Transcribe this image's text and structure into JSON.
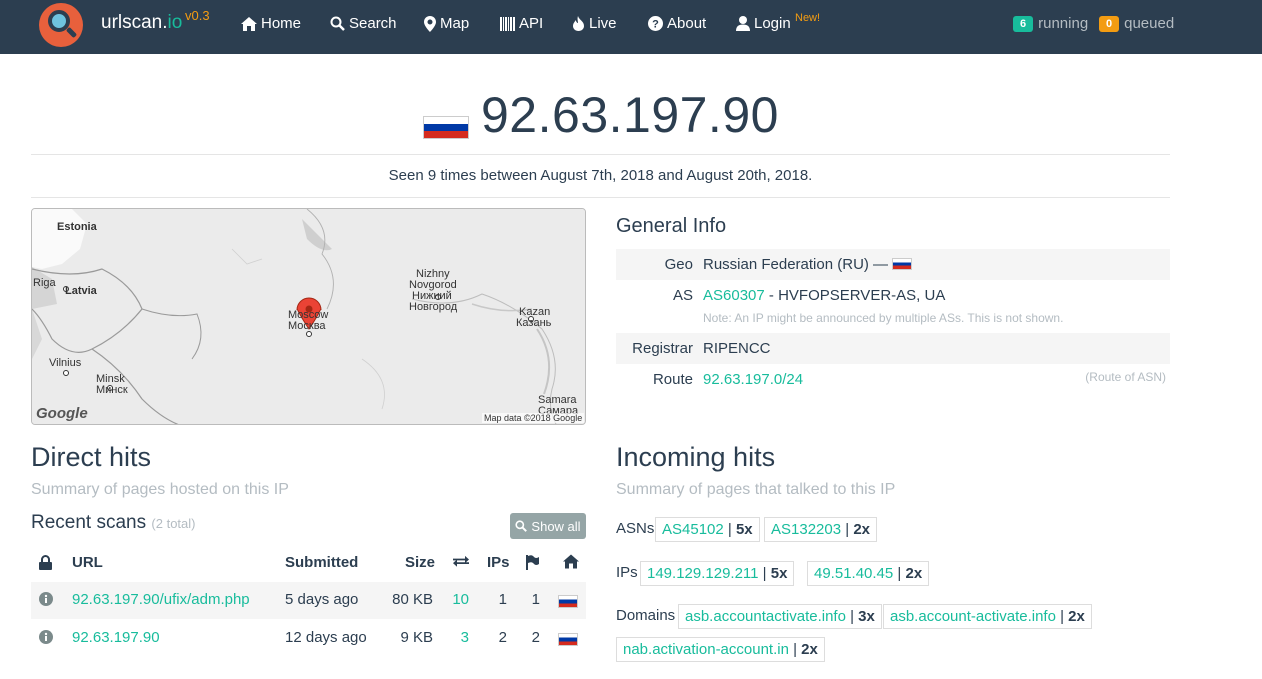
{
  "nav": {
    "brand_main": "urlscan.",
    "brand_io": "io",
    "version": "v0.3",
    "items": [
      "Home",
      "Search",
      "Map",
      "API",
      "Live",
      "About",
      "Login"
    ],
    "login_new": "New!",
    "running_count": "6",
    "running_label": "running",
    "queued_count": "0",
    "queued_label": "queued"
  },
  "hero": {
    "ip": "92.63.197.90",
    "seen": "Seen 9 times between August 7th, 2018 and August 20th, 2018."
  },
  "map": {
    "labels": {
      "estonia": "Estonia",
      "riga": "Riga",
      "latvia": "Latvia",
      "vilnius": "Vilnius",
      "minsk1": "Minsk",
      "minsk2": "Минск",
      "moscow1": "Moscow",
      "moscow2": "Москва",
      "nizhny1": "Nizhny",
      "nizhny2": "Novgorod",
      "nizhny3": "Нижний",
      "nizhny4": "Новгород",
      "kazan1": "Kazan",
      "kazan2": "Казань",
      "samara1": "Samara",
      "samara2": "Самара"
    },
    "google": "Google",
    "attribution": "Map data ©2018 Google"
  },
  "general": {
    "title": "General Info",
    "geo_key": "Geo",
    "geo_val": "Russian Federation (RU) —",
    "as_key": "AS",
    "as_link": "AS60307",
    "as_rest": " - HVFOPSERVER-AS, UA",
    "as_note": "Note: An IP might be announced by multiple ASs. This is not shown.",
    "registrar_key": "Registrar",
    "registrar_val": "RIPENCC",
    "route_key": "Route",
    "route_val": "92.63.197.0/24",
    "route_note": "(Route of ASN)"
  },
  "direct": {
    "title": "Direct hits",
    "subtitle": "Summary of pages hosted on this IP",
    "recent": "Recent scans",
    "recent_count": "(2 total)",
    "show_all": "Show all",
    "headers": {
      "url": "URL",
      "submitted": "Submitted",
      "size": "Size",
      "ips": "IPs"
    },
    "rows": [
      {
        "url": "92.63.197.90/ufix/adm.php",
        "submitted": "5 days ago",
        "size": "80 KB",
        "requests": "10",
        "ips": "1",
        "countries": "1"
      },
      {
        "url": "92.63.197.90",
        "submitted": "12 days ago",
        "size": "9 KB",
        "requests": "3",
        "ips": "2",
        "countries": "2"
      }
    ]
  },
  "incoming": {
    "title": "Incoming hits",
    "subtitle": "Summary of pages that talked to this IP",
    "asns_label": "ASNs",
    "ips_label": "IPs",
    "domains_label": "Domains",
    "asns": [
      {
        "name": "AS45102",
        "count": "5x"
      },
      {
        "name": "AS132203",
        "count": "2x"
      }
    ],
    "ips": [
      {
        "name": "149.129.129.211",
        "count": "5x"
      },
      {
        "name": "49.51.40.45",
        "count": "2x"
      }
    ],
    "domains": [
      {
        "name": "asb.accountactivate.info",
        "count": "3x"
      },
      {
        "name": "asb.account-activate.info",
        "count": "2x"
      },
      {
        "name": "nab.activation-account.in",
        "count": "2x"
      }
    ]
  },
  "colors": {
    "navbar": "#2c3e50",
    "accent": "#18bc9c",
    "warning": "#f39c12",
    "muted": "#b4bcc2"
  }
}
